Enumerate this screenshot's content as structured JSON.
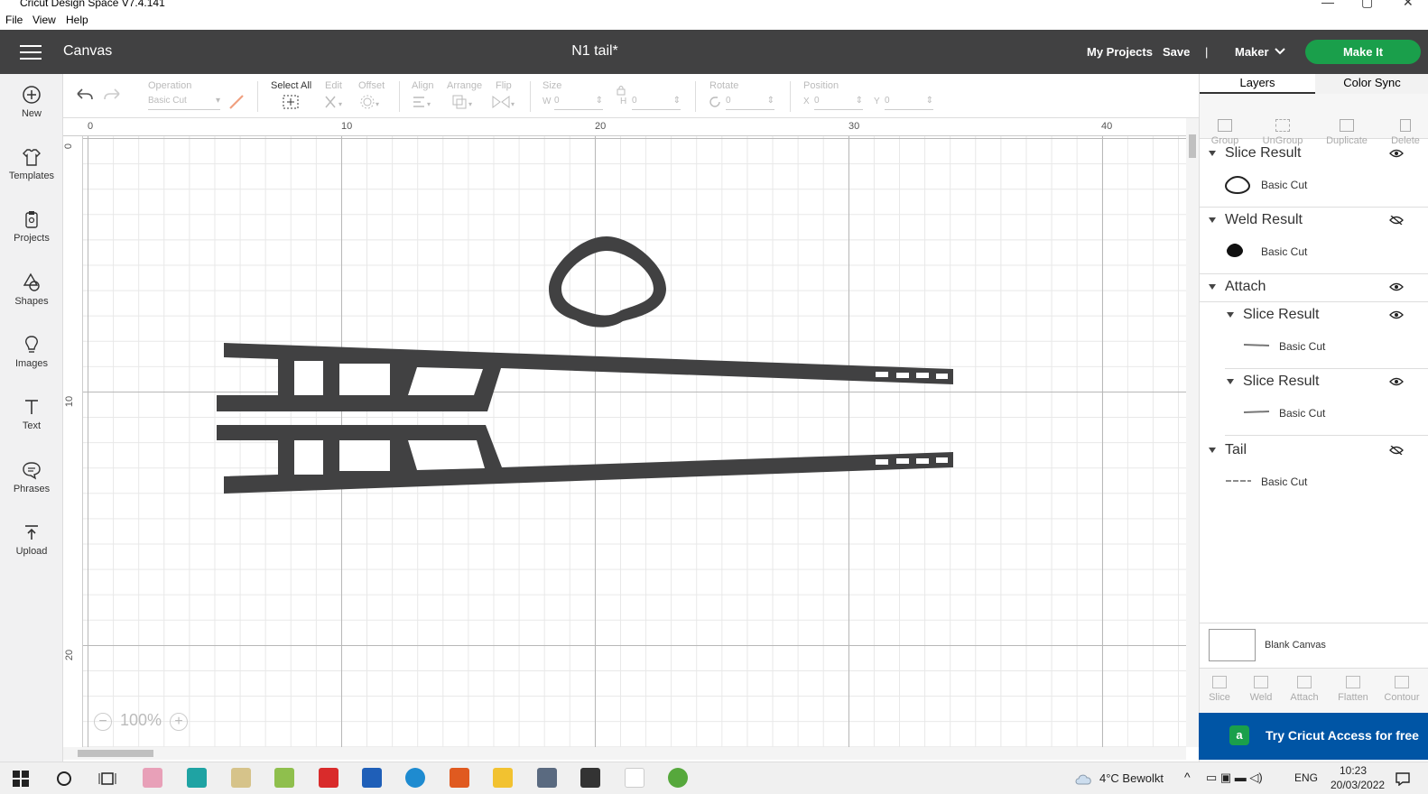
{
  "window": {
    "title": "Cricut Design Space  V7.4.141"
  },
  "menubar": [
    "File",
    "View",
    "Help"
  ],
  "header": {
    "section": "Canvas",
    "project_name": "N1 tail*",
    "my_projects": "My Projects",
    "save": "Save",
    "divider": "|",
    "machine": "Maker",
    "make_it": "Make It"
  },
  "sidebar": [
    {
      "label": "New",
      "icon": "plus-circle-icon"
    },
    {
      "label": "Templates",
      "icon": "shirt-icon"
    },
    {
      "label": "Projects",
      "icon": "clipboard-icon"
    },
    {
      "label": "Shapes",
      "icon": "shapes-icon"
    },
    {
      "label": "Images",
      "icon": "lightbulb-icon"
    },
    {
      "label": "Text",
      "icon": "text-icon"
    },
    {
      "label": "Phrases",
      "icon": "speech-bubble-icon"
    },
    {
      "label": "Upload",
      "icon": "upload-icon"
    }
  ],
  "toolbar": {
    "operation_label": "Operation",
    "operation_value": "Basic Cut",
    "select_all": "Select All",
    "edit": "Edit",
    "offset": "Offset",
    "align": "Align",
    "arrange": "Arrange",
    "flip": "Flip",
    "size": "Size",
    "w": "W",
    "w_value": "0",
    "h": "H",
    "h_value": "0",
    "rotate": "Rotate",
    "rotate_value": "0",
    "position": "Position",
    "x": "X",
    "x_value": "0",
    "y": "Y",
    "y_value": "0"
  },
  "ruler": {
    "top": [
      "0",
      "10",
      "20",
      "30",
      "40"
    ],
    "left": [
      "0",
      "10",
      "20"
    ]
  },
  "zoom": {
    "value": "100%",
    "minus": "−",
    "plus": "+"
  },
  "right_panel": {
    "tabs": [
      "Layers",
      "Color Sync"
    ],
    "tools": [
      "Group",
      "UnGroup",
      "Duplicate",
      "Delete"
    ],
    "layers": [
      {
        "title": "Slice Result",
        "sub": "Basic Cut",
        "visible": true
      },
      {
        "title": "Weld Result",
        "sub": "Basic Cut",
        "visible": false
      },
      {
        "title": "Attach",
        "visible": true
      },
      {
        "title": "Slice Result",
        "sub": "Basic Cut",
        "visible": true
      },
      {
        "title": "Slice Result",
        "sub": "Basic Cut",
        "visible": true
      },
      {
        "title": "Tail",
        "sub": "Basic Cut",
        "visible": false
      }
    ],
    "blank_canvas": "Blank Canvas",
    "bottom_tools": [
      "Slice",
      "Weld",
      "Attach",
      "Flatten",
      "Contour"
    ],
    "access_banner": "Try Cricut Access for free"
  },
  "taskbar": {
    "weather": "4°C  Bewolkt",
    "language": "ENG",
    "time": "10:23",
    "date": "20/03/2022"
  },
  "colors": {
    "header_bg": "#414142",
    "make_it": "#1a9f4b",
    "shape_fill": "#414142",
    "access_bg": "#0055a5"
  }
}
